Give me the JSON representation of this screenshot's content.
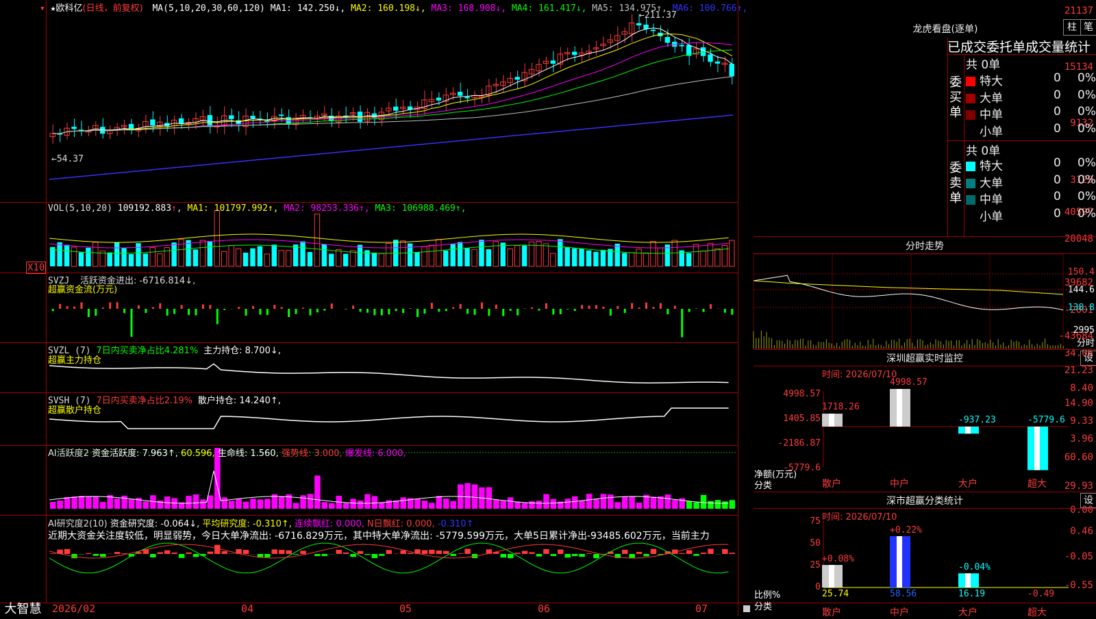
{
  "brand": "大智慧",
  "main": {
    "title_star": "★",
    "stock_name": "欧科亿",
    "period_note": "(日线，前复权)",
    "ma_label": "MA(5,10,20,30,60,120)",
    "ma_values": [
      {
        "label": "MA1:",
        "value": "142.250",
        "arrow": "↓",
        "color": "#ffffff"
      },
      {
        "label": "MA2:",
        "value": "160.198",
        "arrow": "↓",
        "color": "#ffff00"
      },
      {
        "label": "MA3:",
        "value": "168.908",
        "arrow": "↓",
        "color": "#ff00ff"
      },
      {
        "label": "MA4:",
        "value": "161.417",
        "arrow": "↓",
        "color": "#00ff00"
      },
      {
        "label": "MA5:",
        "value": "134.975",
        "arrow": "↑",
        "color": "#c0c0c0"
      },
      {
        "label": "MA6:",
        "value": "100.766",
        "arrow": "↑",
        "color": "#3333ff"
      }
    ],
    "y_ticks": [
      "21137",
      "15134",
      "9132",
      "3129"
    ],
    "high_label": "211.37",
    "low_label": "54.37"
  },
  "vol": {
    "label": "VOL(5,10,20)",
    "value": "109192.883",
    "ma": [
      {
        "label": "MA1:",
        "value": "101797.992",
        "arrow": "↑",
        "color": "#ffff00"
      },
      {
        "label": "MA2:",
        "value": "98253.336",
        "arrow": "↑",
        "color": "#ff00ff"
      },
      {
        "label": "MA3:",
        "value": "106988.469",
        "arrow": "↑",
        "color": "#00ff00"
      }
    ],
    "y_ticks": [
      "40597",
      "20048",
      "X10"
    ]
  },
  "svzj": {
    "label": "SVZJ",
    "desc": "活跃资金进出: -6716.814↓,",
    "sub": "超赢资金流(万元)",
    "y_ticks": [
      "39682",
      "-2001",
      "-43684"
    ]
  },
  "svzl": {
    "label": "SVZL (7)",
    "desc1": "7日内买卖净占比4.281%",
    "desc2": "主力持仓: 8.700↓,",
    "sub": "超赢主力持仓",
    "y_ticks": [
      "34.06",
      "21.23",
      "8.40"
    ]
  },
  "svsh": {
    "label": "SVSH (7)",
    "desc1": "7日内买卖净占比2.19%",
    "desc2": "散户持仓: 14.240↑,",
    "sub": "超赢散户持仓",
    "y_ticks": [
      "14.90",
      "9.33",
      "3.96"
    ]
  },
  "ai_active": {
    "label": "AI活跃度2",
    "desc1": "资金活跃度: 7.963↑,",
    "desc2": "60.596,",
    "desc3": "生命线: 1.560,",
    "desc4": "强势线: 3.000,",
    "desc5": "爆发线: 6.000,",
    "y_ticks": [
      "60.60",
      "29.93",
      "0.00"
    ]
  },
  "ai_research": {
    "label": "AI研究度2(10)",
    "desc1": "资金研究度: -0.064↓,",
    "desc2": "平均研究度: -0.310↑,",
    "desc3": "连续飘红: 0.000,",
    "desc4": "N日飘红: 0.000,",
    "desc5": "-0.310↑",
    "comment": "近期大资金关注度较低，明显弱势，今日大单净流出: -6716.829万元，其中特大单净流出: -5779.599万元，大单5日累计净出-93485.602万元，当前主力",
    "y_ticks": [
      "0.46",
      "-0.05",
      "-0.55"
    ]
  },
  "x_axis": [
    "2026/02",
    "04",
    "05",
    "06",
    "07"
  ],
  "right": {
    "longhu_title": "龙虎看盘(逐单)",
    "btn_col": "柱",
    "btn_pen": "笔",
    "table_header": "已成交委托单成交量统计",
    "buy_label": "委买单",
    "sell_label": "委卖单",
    "buy_total": "共 0单",
    "sell_total": "共 0单",
    "buy_rows": [
      {
        "name": "特大",
        "count": "0",
        "pct": "0%",
        "color": "#ff0000"
      },
      {
        "name": "大单",
        "count": "0",
        "pct": "0%",
        "color": "#a00000"
      },
      {
        "name": "中单",
        "count": "0",
        "pct": "0%",
        "color": "#800000"
      },
      {
        "name": "小单",
        "count": "0",
        "pct": "0%",
        "color": "#000000"
      }
    ],
    "sell_rows": [
      {
        "name": "特大",
        "count": "0",
        "pct": "0%",
        "color": "#00ffff"
      },
      {
        "name": "大单",
        "count": "0",
        "pct": "0%",
        "color": "#008080"
      },
      {
        "name": "中单",
        "count": "0",
        "pct": "0%",
        "color": "#006a6a"
      },
      {
        "name": "小单",
        "count": "0",
        "pct": "0%",
        "color": "#000000"
      }
    ],
    "intraday_title": "分时走势",
    "intraday_ticks": [
      "150.4",
      "144.6",
      "138.8",
      "2995",
      "分时"
    ],
    "sz_monitor_title": "深圳超赢实时监控",
    "sz_set": "设",
    "sz_time": "时间: 2026/07/10",
    "sz_axis": [
      "4998.57",
      "1405.85",
      "-2186.87",
      "-5779.6"
    ],
    "sz_net_label": "净额(万元)",
    "sz_class_label": "分类",
    "sz_bars": [
      {
        "name": "散户",
        "value": "1718.26"
      },
      {
        "name": "中户",
        "value": "4998.57"
      },
      {
        "name": "大户",
        "value": "-937.23"
      },
      {
        "name": "超大",
        "value": "-5779.6"
      }
    ],
    "sc_title": "深市超赢分类统计",
    "sc_set": "设",
    "sc_time": "时间: 2026/07/10",
    "sc_axis": [
      "75",
      "50",
      "25",
      "0"
    ],
    "sc_ratio_label": "比例%",
    "sc_class_label": "分类",
    "sc_bars": [
      {
        "name": "散户",
        "value": "25.74",
        "chg": "+0.08%"
      },
      {
        "name": "中户",
        "value": "58.56",
        "chg": "+0.22%"
      },
      {
        "name": "大户",
        "value": "16.19",
        "chg": "-0.04%"
      },
      {
        "name": "超大",
        "value": "-0.49",
        "chg": ""
      }
    ]
  }
}
